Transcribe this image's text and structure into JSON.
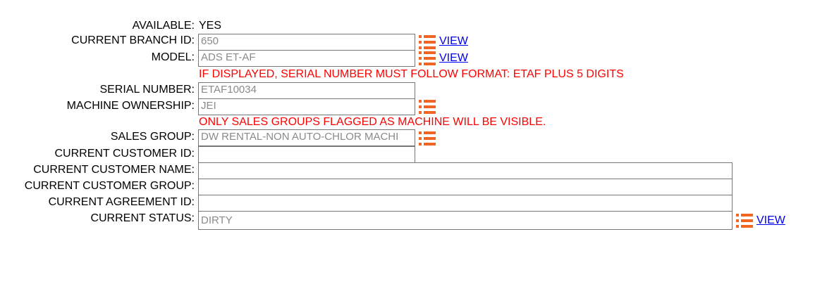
{
  "colors": {
    "warning_text": "#ff0000",
    "icon_orange": "#f26522",
    "link_blue": "#0000ee"
  },
  "form": {
    "available": {
      "label": "AVAILABLE:",
      "value": "YES"
    },
    "branch_id": {
      "label": "CURRENT BRANCH ID:",
      "value": "650",
      "link": "VIEW",
      "icon": "list-icon"
    },
    "model": {
      "label": "MODEL:",
      "value": "ADS ET-AF",
      "link": "VIEW",
      "icon": "list-icon"
    },
    "serial_warning": "IF DISPLAYED, SERIAL NUMBER MUST FOLLOW FORMAT: ETAF PLUS 5 DIGITS",
    "serial_number": {
      "label": "SERIAL NUMBER:",
      "value": "ETAF10034"
    },
    "machine_ownership": {
      "label": "MACHINE OWNERSHIP:",
      "value": "JEI",
      "icon": "list-icon"
    },
    "sales_group_warning": "ONLY SALES GROUPS FLAGGED AS MACHINE WILL BE VISIBLE.",
    "sales_group": {
      "label": "SALES GROUP:",
      "value": "DW RENTAL-NON AUTO-CHLOR MACHI",
      "icon": "list-icon"
    },
    "customer_id": {
      "label": "CURRENT CUSTOMER ID:",
      "value": ""
    },
    "customer_name": {
      "label": "CURRENT CUSTOMER NAME:",
      "value": ""
    },
    "customer_group": {
      "label": "CURRENT CUSTOMER GROUP:",
      "value": ""
    },
    "agreement_id": {
      "label": "CURRENT AGREEMENT ID:",
      "value": ""
    },
    "status": {
      "label": "CURRENT STATUS:",
      "value": "DIRTY",
      "link": "VIEW",
      "icon": "list-icon"
    }
  }
}
